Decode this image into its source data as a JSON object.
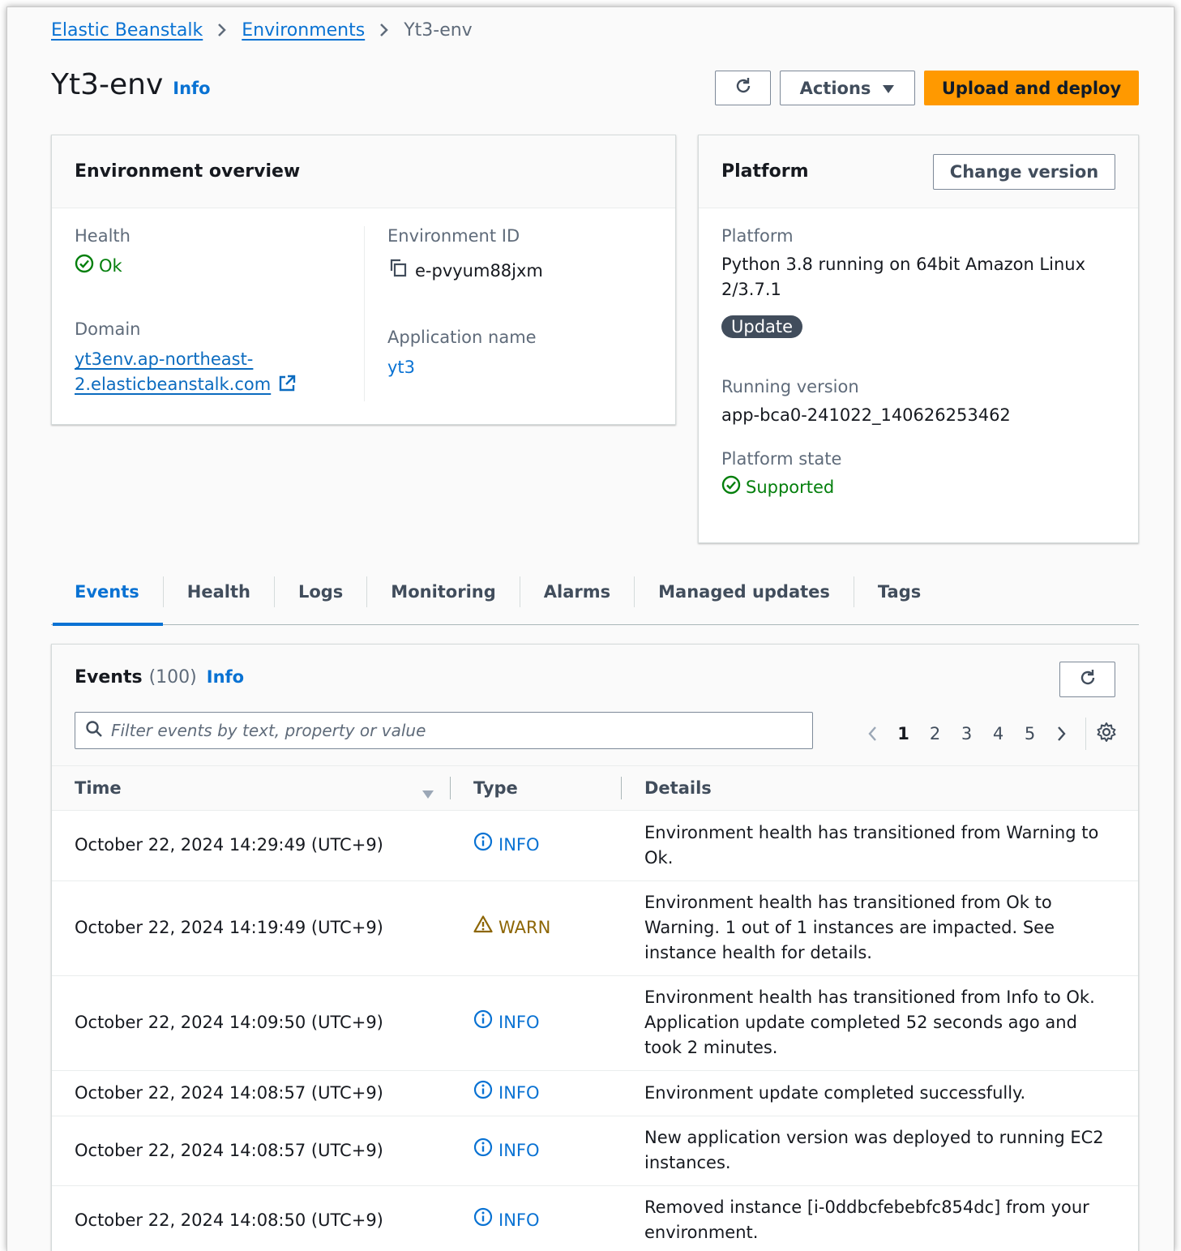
{
  "breadcrumb": {
    "items": [
      "Elastic Beanstalk",
      "Environments"
    ],
    "current": "Yt3-env"
  },
  "header": {
    "title": "Yt3-env",
    "info": "Info",
    "actions_label": "Actions",
    "upload_label": "Upload and deploy"
  },
  "overview": {
    "title": "Environment overview",
    "health_label": "Health",
    "health_value": "Ok",
    "domain_label": "Domain",
    "domain_line1": "yt3env.ap-northeast-",
    "domain_line2": "2.elasticbeanstalk.com",
    "env_id_label": "Environment ID",
    "env_id_value": "e-pvyum88jxm",
    "app_name_label": "Application name",
    "app_name_value": "yt3"
  },
  "platform": {
    "title": "Platform",
    "change_version_label": "Change version",
    "platform_label": "Platform",
    "platform_line1": "Python 3.8 running on 64bit Amazon Linux",
    "platform_line2": "2/3.7.1",
    "update_badge": "Update",
    "running_version_label": "Running version",
    "running_version_value": "app-bca0-241022_140626253462",
    "state_label": "Platform state",
    "state_value": "Supported"
  },
  "tabs": [
    "Events",
    "Health",
    "Logs",
    "Monitoring",
    "Alarms",
    "Managed updates",
    "Tags"
  ],
  "events": {
    "title": "Events",
    "count": "(100)",
    "info": "Info",
    "search_placeholder": "Filter events by text, property or value",
    "pages": [
      "1",
      "2",
      "3",
      "4",
      "5"
    ],
    "columns": {
      "time": "Time",
      "type": "Type",
      "details": "Details"
    },
    "rows": [
      {
        "time": "October 22, 2024 14:29:49 (UTC+9)",
        "type": "INFO",
        "details": "Environment health has transitioned from Warning to Ok."
      },
      {
        "time": "October 22, 2024 14:19:49 (UTC+9)",
        "type": "WARN",
        "details": "Environment health has transitioned from Ok to Warning. 1 out of 1 instances are impacted. See instance health for details."
      },
      {
        "time": "October 22, 2024 14:09:50 (UTC+9)",
        "type": "INFO",
        "details": "Environment health has transitioned from Info to Ok. Application update completed 52 seconds ago and took 2 minutes."
      },
      {
        "time": "October 22, 2024 14:08:57 (UTC+9)",
        "type": "INFO",
        "details": "Environment update completed successfully."
      },
      {
        "time": "October 22, 2024 14:08:57 (UTC+9)",
        "type": "INFO",
        "details": "New application version was deployed to running EC2 instances."
      },
      {
        "time": "October 22, 2024 14:08:50 (UTC+9)",
        "type": "INFO",
        "details": "Removed instance [i-0ddbcfebebfc854dc] from your environment."
      }
    ]
  },
  "colors": {
    "link": "#0972d3",
    "primary": "#ff9900",
    "success": "#037f0c",
    "warning": "#8d6605"
  }
}
